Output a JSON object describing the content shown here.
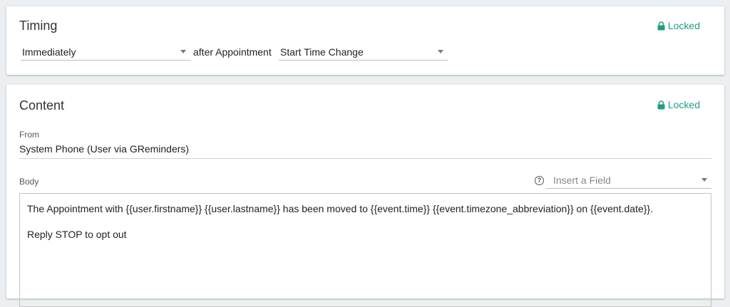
{
  "timing": {
    "title": "Timing",
    "lock_label": "Locked",
    "delay_select": {
      "value": "Immediately"
    },
    "connector_text": "after Appointment",
    "trigger_select": {
      "value": "Start Time Change"
    }
  },
  "content": {
    "title": "Content",
    "lock_label": "Locked",
    "from_label": "From",
    "from_value": "System Phone (User via GReminders)",
    "body_label": "Body",
    "insert_field_placeholder": "Insert a Field",
    "body_lines": [
      "The Appointment with {{user.firstname}} {{user.lastname}} has been moved to {{event.time}} {{event.timezone_abbreviation}} on {{event.date}}.",
      "Reply STOP to opt out"
    ]
  },
  "colors": {
    "accent": "#1e9e84",
    "background": "#eceff1"
  },
  "icons": {
    "lock": "lock-icon",
    "help": "help-circle-icon",
    "caret": "caret-down-icon"
  }
}
